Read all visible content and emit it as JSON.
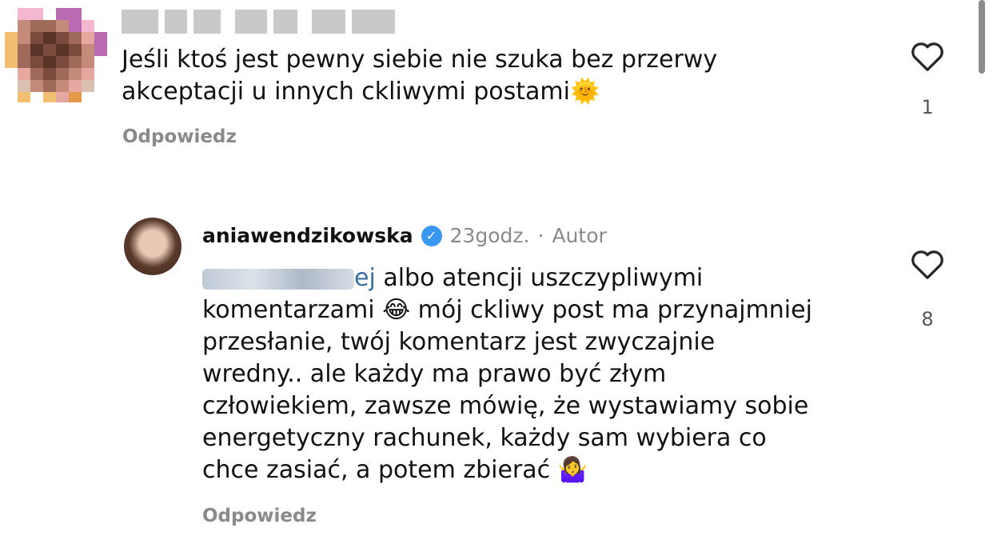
{
  "comments": [
    {
      "text_line1": "Jeśli ktoś jest pewny siebie nie szuka bez przerwy",
      "text_line2": "akceptacji u innych ckliwymi postami",
      "emoji": "🌞",
      "reply_label": "Odpowiedz",
      "likes": "1"
    },
    {
      "username": "aniawendzikowska",
      "time": "23godz.",
      "separator": "·",
      "role": "Autor",
      "mention_suffix": "ej",
      "text_line1": " albo atencji uszczypliwymi",
      "text_line2a": "komentarzami",
      "emoji1": "😂",
      "text_line2b": " mój ckliwy post ma przynajmniej",
      "text_line3": "przesłanie, twój komentarz jest zwyczajnie",
      "text_line4": "wredny.. ale każdy ma prawo być złym",
      "text_line5": "człowiekiem, zawsze mówię, że wystawiamy sobie",
      "text_line6": "energetyczny rachunek, każdy sam wybiera co",
      "text_line7": "chce zasiać, a potem zbierać",
      "emoji2": "🤷‍♀️",
      "reply_label": "Odpowiedz",
      "likes": "8"
    }
  ],
  "icons": {
    "heart": "heart-outline-icon",
    "verified": "verified-badge-icon"
  },
  "colors": {
    "verified": "#3897f0",
    "muted": "#8a8a8a",
    "text": "#121212"
  }
}
